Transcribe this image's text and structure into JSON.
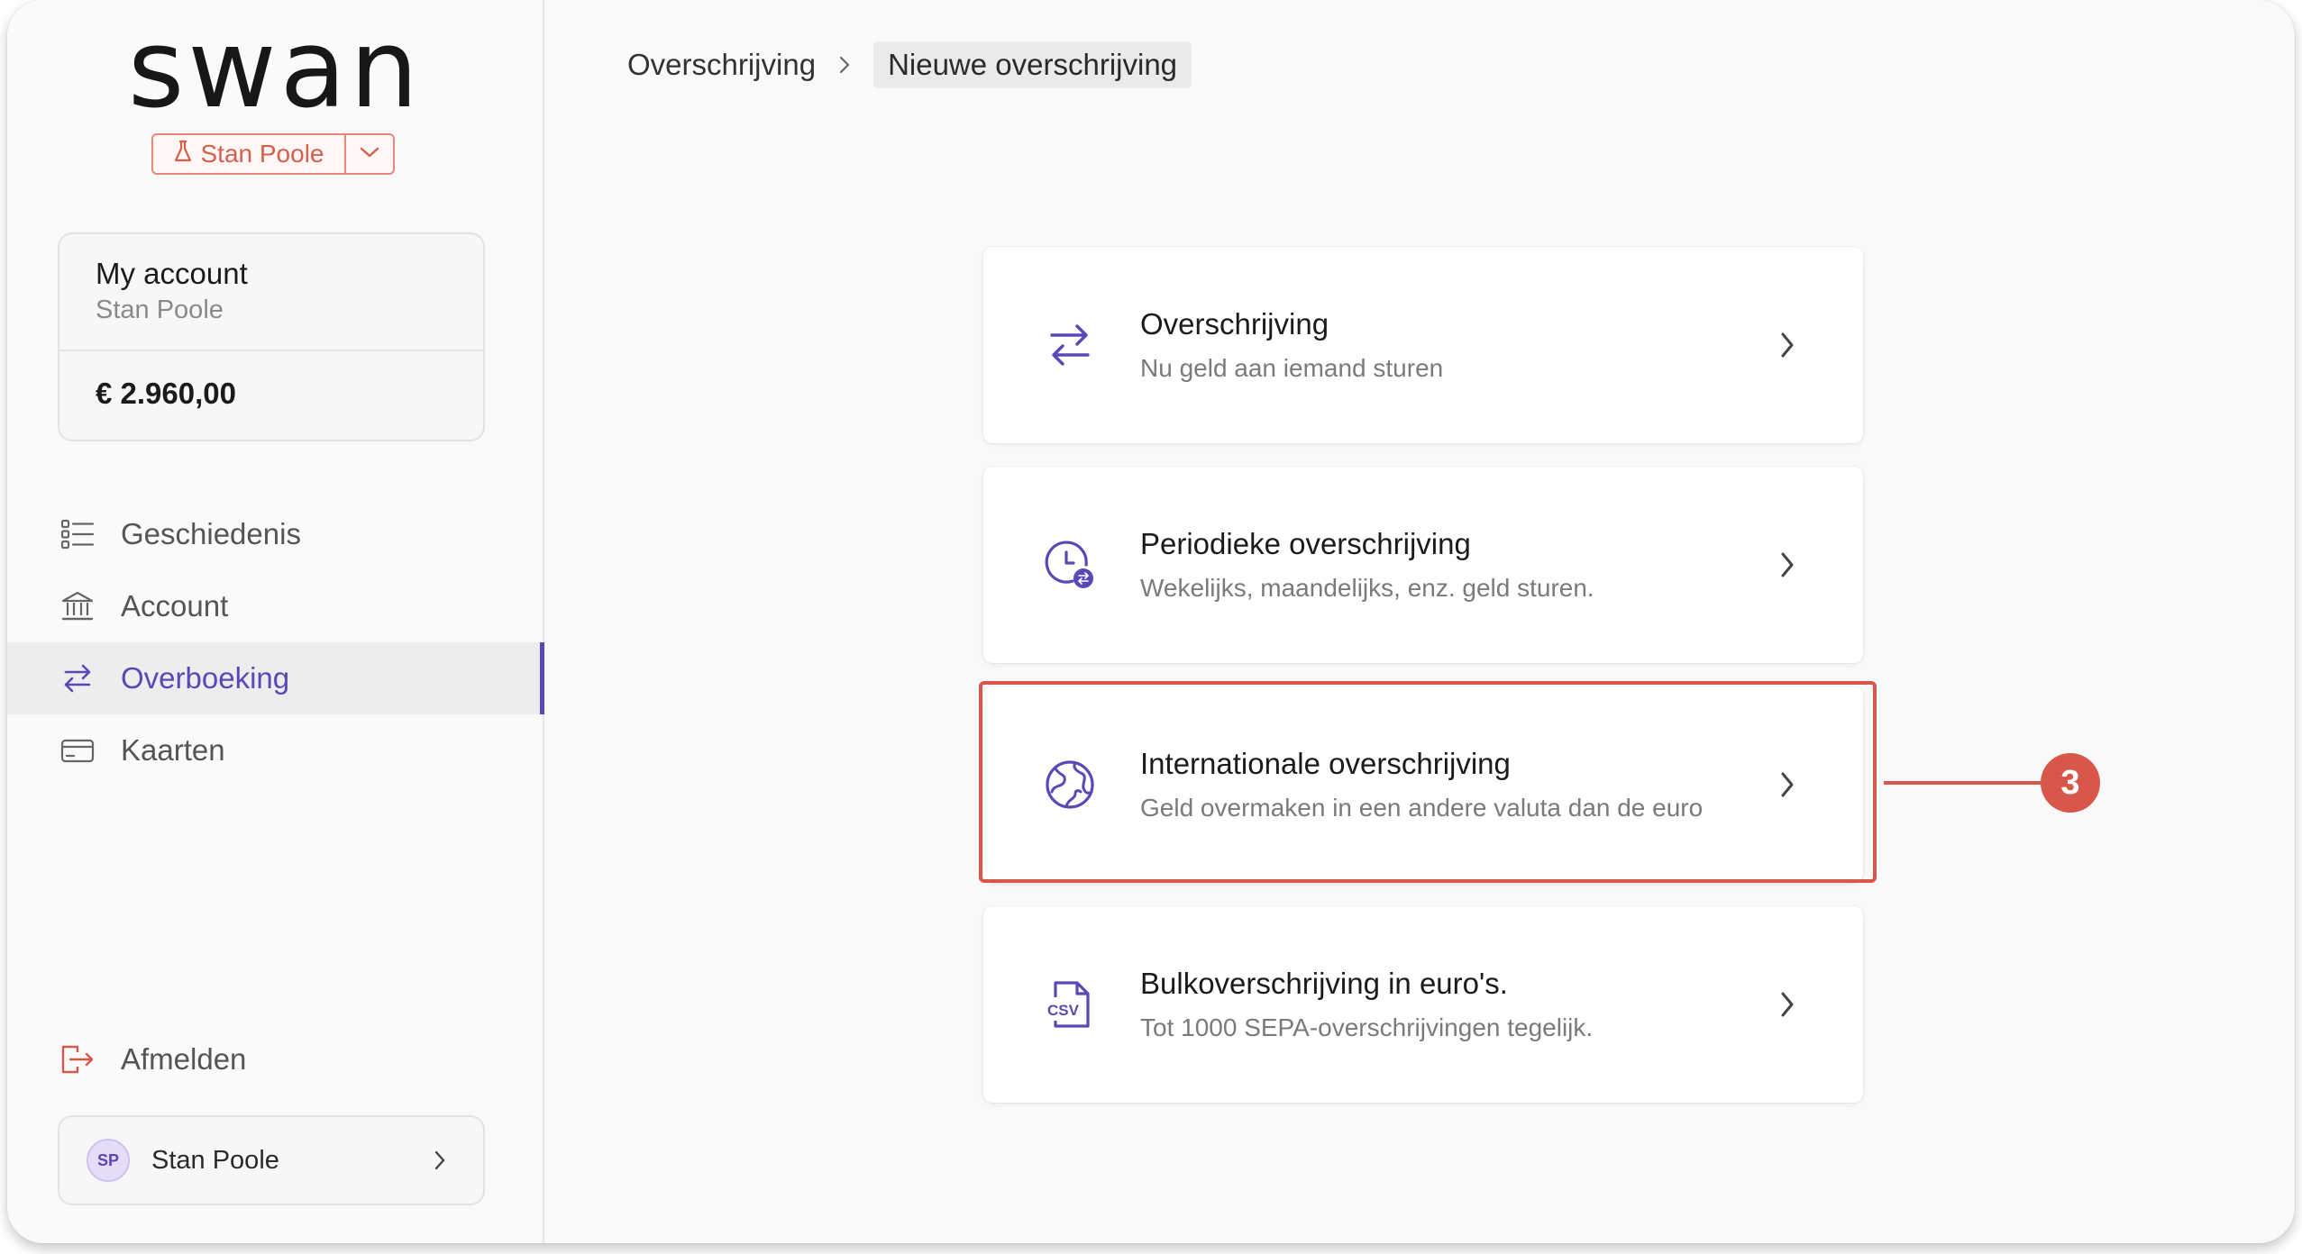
{
  "app": {
    "logo": "swan",
    "project": "Stan Poole",
    "accent_color": "#5b47b5",
    "highlight_color": "#d9574a"
  },
  "account": {
    "title": "My account",
    "owner": "Stan Poole",
    "balance": "€ 2.960,00"
  },
  "nav": {
    "items": [
      {
        "label": "Geschiedenis",
        "icon": "list-icon",
        "active": false
      },
      {
        "label": "Account",
        "icon": "bank-icon",
        "active": false
      },
      {
        "label": "Overboeking",
        "icon": "transfer-icon",
        "active": true
      },
      {
        "label": "Kaarten",
        "icon": "card-icon",
        "active": false
      }
    ],
    "logout": "Afmelden"
  },
  "user": {
    "initials": "SP",
    "name": "Stan Poole"
  },
  "breadcrumb": {
    "parent": "Overschrijving",
    "current": "Nieuwe overschrijving"
  },
  "options": [
    {
      "title": "Overschrijving",
      "description": "Nu geld aan iemand sturen",
      "icon": "transfer-icon"
    },
    {
      "title": "Periodieke overschrijving",
      "description": "Wekelijks, maandelijks, enz. geld sturen.",
      "icon": "recurring-clock-icon"
    },
    {
      "title": "Internationale overschrijving",
      "description": "Geld overmaken in een andere valuta dan de euro",
      "icon": "globe-icon"
    },
    {
      "title": "Bulkoverschrijving in euro's.",
      "description": "Tot 1000 SEPA-overschrijvingen tegelijk.",
      "icon": "csv-file-icon"
    }
  ],
  "callout": {
    "number": "3"
  }
}
